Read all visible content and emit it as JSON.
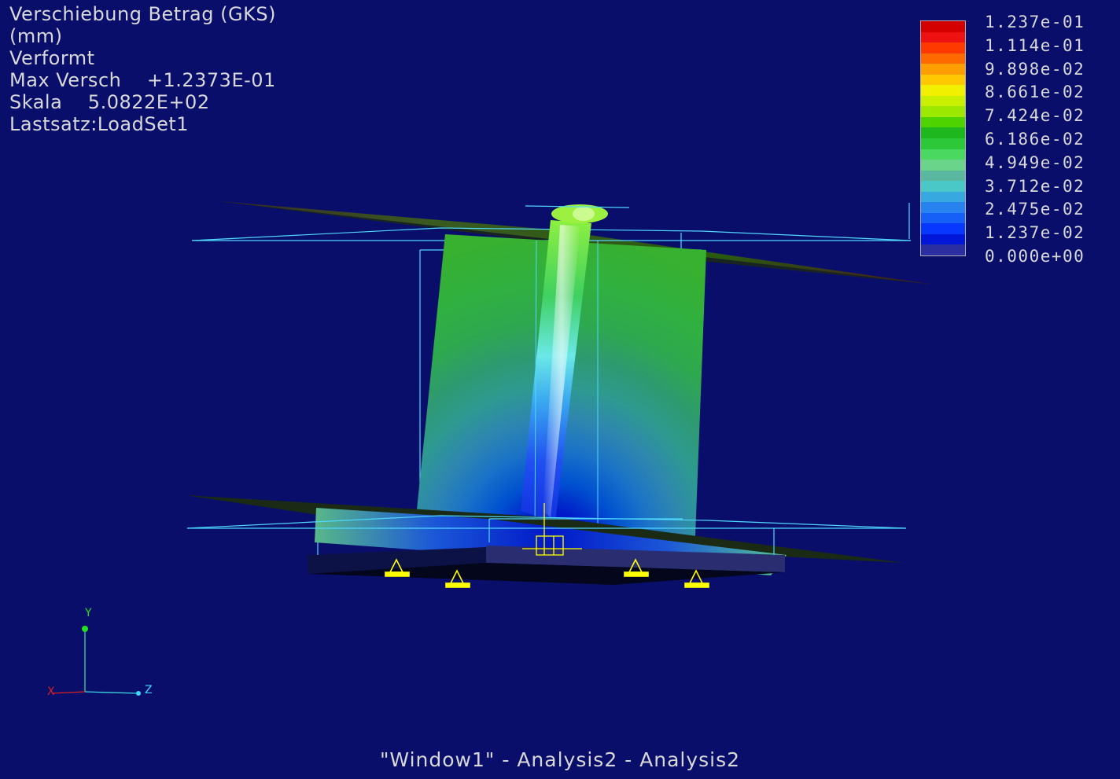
{
  "info": {
    "lines": [
      "Verschiebung Betrag (GKS)",
      "(mm)",
      "Verformt",
      "Max Versch    +1.2373E-01",
      "Skala    5.0822E+02",
      "Lastsatz:LoadSet1"
    ]
  },
  "legend": {
    "labels": [
      "1.237e-01",
      "1.114e-01",
      "9.898e-02",
      "8.661e-02",
      "7.424e-02",
      "6.186e-02",
      "4.949e-02",
      "3.712e-02",
      "2.475e-02",
      "1.237e-02",
      "0.000e+00"
    ],
    "band_colors": [
      "#d40000",
      "#ee1111",
      "#ff3a00",
      "#ff6a00",
      "#ff9e00",
      "#ffc800",
      "#f0f000",
      "#c8f000",
      "#9ce800",
      "#4ed200",
      "#1eb81e",
      "#2cc83a",
      "#4ad860",
      "#6ad48a",
      "#5ab8a0",
      "#4ac8c8",
      "#38a8e0",
      "#2882f0",
      "#1660f8",
      "#0838ff",
      "#0016d8",
      "#2a2ea0"
    ]
  },
  "axes": {
    "y": "Y",
    "x": "X",
    "z": "Z"
  },
  "caption": "\"Window1\" - Analysis2 - Analysis2",
  "colors": {
    "background": "#0a0e6b",
    "wireframe": "#4fd8ff",
    "constraint": "#ffff00"
  }
}
